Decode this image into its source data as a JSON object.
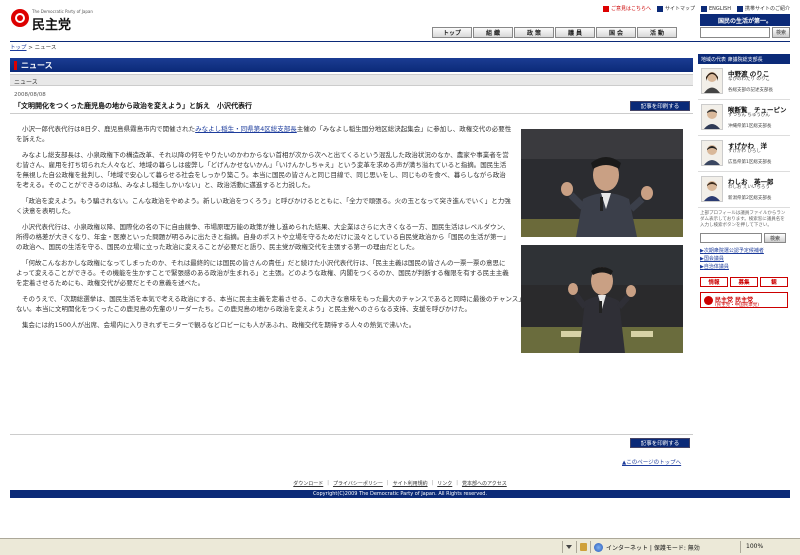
{
  "header": {
    "logo_en": "The Democratic Party of Japan",
    "logo_jp": "民主党",
    "util_links": [
      "ご意見はこちらへ",
      "サイトマップ",
      "ENGLISH",
      "携帯サイトのご紹介"
    ],
    "slogan": "国民の生活が第一。",
    "nav_tabs": [
      "トップ",
      "組 織",
      "政 策",
      "議 員",
      "国 会",
      "活 動"
    ],
    "search_button": "検索",
    "search_value": ""
  },
  "breadcrumb": {
    "home": "トップ",
    "sep": ">",
    "current": "ニュース"
  },
  "section": {
    "title": "ニュース",
    "subtitle": "ニュース"
  },
  "article": {
    "date": "2008/08/08",
    "headline": "「文明開化をつくった鹿児島の地から政治を変えよう」と訴え　小沢代表行",
    "print_label": "記事を印刷する",
    "p1_a": "小沢一郎代表代行は8日夕、鹿児島県霧島市内で開催された",
    "p1_link": "みなよし稲生・同県第4区総支部長",
    "p1_b": "主催の「みなよし稲生国分地区総決起集会」に参加し、政権交代の必要性を訴えた。",
    "p2": "みなよし総支部長は、小泉政権下の構造改革、それ以降の何をやりたいのかわからない首相が次から次へと出てくるという混乱した政治状況のなか、農家や事業者を営む皆さん、雇用を打ち切られた人々など、地域の暮らしは疲弊し「どげんかせないかん」「いけんかしちゃえ」という変革を求める声が満ち溢れていると指摘。国民生活を無視した自公政権を批判し、「地域で安心して暮らせる社会をしっかり築こう。本当に国民の皆さんと同じ目線で、同じ思いをし、同じものを食べ、暮らしながら政治を考える。そのことができるのは私、みなよし稲生しかいない」と、政治活動に邁進すると力説した。",
    "p3": "「政治を変えよう。もう騙されない。こんな政治をやめよう。新しい政治をつくろう」と呼びかけるとともに、「全力で頑張る。火の玉となって突き進んでいく」と力強く決意を表明した。",
    "p4": "小沢代表代行は、小泉政権以降、国際化の名の下に自由競争、市場原理万能の政策が推し進められた結果、大企業はさらに大きくなる一方、国民生活はレベルダウン、所得の格差が大きくなり、年金・医療といった問題が明るみに出たきと指摘。自身のポストや立場を守るためだけに汲々としている自民党政治から「国民の生活が第一」の政治へ、国民の生活を守る、国民の立場に立った政治に変えることが必要だと語り、民主党が政権交代を主張する第一の理由だとした。",
    "p5": "「何故こんなおかしな政権になってしまったのか、それは最終的には国民の皆さんの責任」だと続けた小沢代表代行は、「民主主義は国民の皆さんの一票一票の意思によって変えることができる。その機能を生かすことで緊張感のある政治が生まれる」と主張。どのような政権、内閣をつくるのか、国民が判断する権限を有する民主主義を定着させるためにも、政権交代が必要だとその意義を述べた。",
    "p6": "そのうえで、「次期総選挙は、国民生活を本気で考える政治にする、本当に民主主義を定着させる、この大きな意味をもった最大のチャンスであると同時に最後のチャンス」だと強調。「そのためには鹿児島から変えなくてはならない。本当に文明開化をつくったこの鹿児島の先輩のリーダーたち。この鹿児島の地から政治を変えよう」と民主党へのさらなる支持、支援を呼びかけた。",
    "p7": "集会には約1500人が出席、会場内に入りきれずモニターで観るなどロビーにも人があふれ、政権交代を期待する人々の熱気で沸いた。",
    "page_top": "▲このページのトップへ"
  },
  "sidebar": {
    "heading": "地域の代表 衆議院総支部長",
    "members": [
      {
        "name": "中野渡 のりこ",
        "kana": "なかのわたり のりこ",
        "block": "各総支部の記述支部長"
      },
      {
        "name": "喉断覧　チューピン",
        "kana": "ずつちん ちゅうびん",
        "block": "沖縄県第1区総支部長"
      },
      {
        "name": "すげかわ　洋",
        "kana": "すげかわ ひろし",
        "block": "広島県第1区総支部長"
      },
      {
        "name": "わしお　英一郎",
        "kana": "わしお えいいちろう",
        "block": "新潟県第2区総支部長"
      }
    ],
    "note": "上部プロフィールは議員ファイルからランダム表示しております。検索窓に議員名を入力し検索ボタンを押して下さい。",
    "search_button": "検索",
    "links": [
      "次期衆院選公認予定候補者",
      "国会議員",
      "自治体議員"
    ],
    "banners": [
      "情報",
      "募集",
      "観",
      "談会"
    ],
    "paper_l1": "民主党 民主党",
    "paper_l2": "(民主党・中国民衆党)"
  },
  "footer": {
    "links": [
      "ダウンロード",
      "プライバシーポリシー",
      "サイト利用規約",
      "リンク",
      "党本部へのアクセス"
    ],
    "copyright": "Copyright(C)2009 The Democratic Party of Japan. All Rights reserved."
  },
  "statusbar": {
    "zone": "インターネット | 保護モード: 無効",
    "zoom": "100%"
  },
  "colors": {
    "brand_navy": "#0b2a78",
    "accent_red": "#dd0000",
    "link_blue": "#1d3c9c"
  }
}
